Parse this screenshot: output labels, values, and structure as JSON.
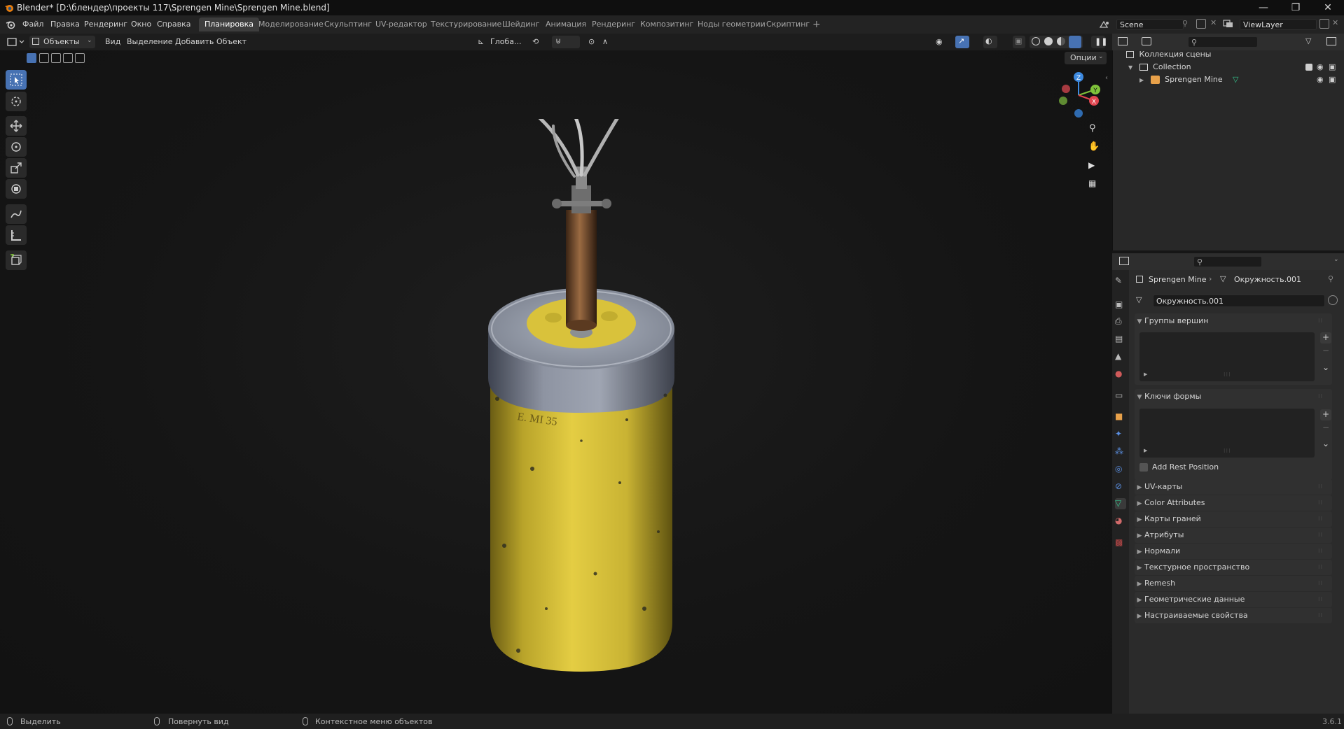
{
  "window": {
    "title": "Blender* [D:\\блендер\\проекты 117\\Sprengen Mine\\Sprengen Mine.blend]",
    "minimize_glyph": "—",
    "restore_glyph": "❐",
    "close_glyph": "✕"
  },
  "menu": [
    "Файл",
    "Правка",
    "Рендеринг",
    "Окно",
    "Справка"
  ],
  "workspaces": [
    "Планировка",
    "Моделирование",
    "Скульптинг",
    "UV-редактор",
    "Текстурирование",
    "Шейдинг",
    "Анимация",
    "Рендеринг",
    "Композитинг",
    "Ноды геометрии",
    "Скриптинг"
  ],
  "workspace_active": 0,
  "workspace_add": "+",
  "scene": {
    "name": "Scene",
    "view_layer": "ViewLayer"
  },
  "viewport": {
    "mode": "Объекты",
    "menus": [
      "Вид",
      "Выделение",
      "Добавить",
      "Объект"
    ],
    "transform_orientation": "Глоба...",
    "options_label": "Опции",
    "gizmo_axes": {
      "x": "X",
      "y": "Y",
      "z": "Z"
    }
  },
  "outliner": {
    "scene_collection": "Коллекция сцены",
    "collection": "Collection",
    "object": "Sprengen Mine"
  },
  "properties": {
    "breadcrumb_object": "Sprengen Mine",
    "breadcrumb_mesh": "Окружность.001",
    "mesh_name": "Окружность.001",
    "vertex_groups": "Группы вершин",
    "shape_keys": "Ключи формы",
    "add_rest_position": "Add Rest Position",
    "add_glyph": "+",
    "remove_glyph": "−",
    "more_glyph": "⌄",
    "panels": [
      "UV-карты",
      "Color Attributes",
      "Карты граней",
      "Атрибуты",
      "Нормали",
      "Текстурное пространство",
      "Remesh",
      "Геометрические данные",
      "Настраиваемые свойства"
    ]
  },
  "status": {
    "select": "Выделить",
    "rotate": "Повернуть вид",
    "context_menu": "Контекстное меню объектов",
    "version": "3.6.1"
  },
  "model_text": "E. MI 35",
  "colors": {
    "accent": "#4772b3",
    "mine_body": "#d8c238",
    "mine_top": "#8f96a4",
    "gizmo_x": "#e0454f",
    "gizmo_y": "#7fc23a",
    "gizmo_z": "#3d8ae0",
    "mesh_icon": "#35c38c"
  }
}
